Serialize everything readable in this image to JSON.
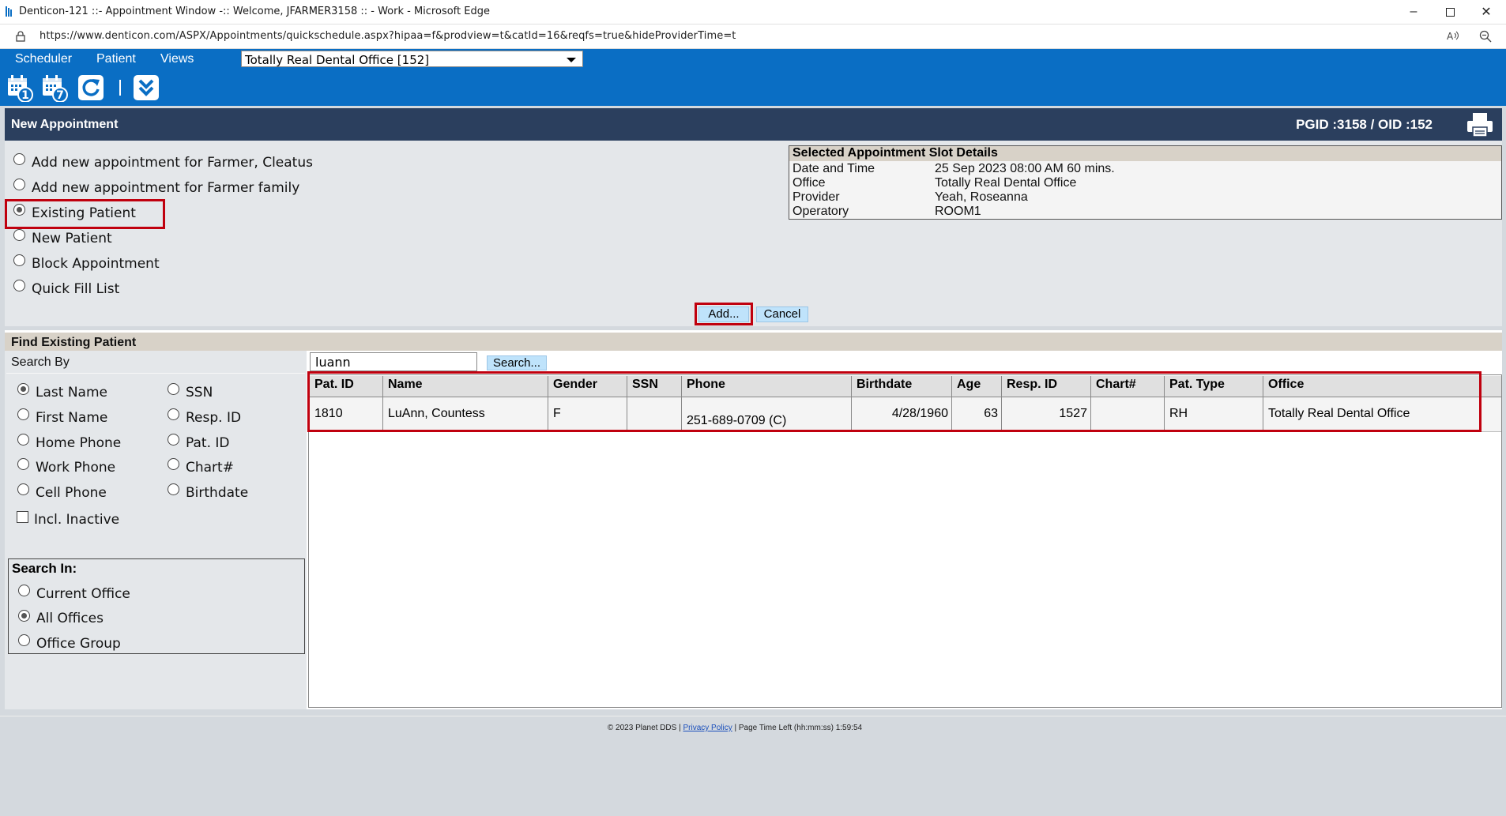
{
  "window": {
    "title": "Denticon-121 ::- Appointment Window -:: Welcome, JFARMER3158 :: - Work - Microsoft Edge",
    "url": "https://www.denticon.com/ASPX/Appointments/quickschedule.aspx?hipaa=f&prodview=t&catId=16&reqfs=true&hideProviderTime=t"
  },
  "menu": {
    "scheduler": "Scheduler",
    "patient": "Patient",
    "views": "Views",
    "office_select": "Totally Real Dental Office [152]"
  },
  "toolbar": {
    "cal1_num": "1",
    "cal7_num": "7"
  },
  "header": {
    "title": "New Appointment",
    "pgid": "PGID :3158  /  OID :152"
  },
  "options": [
    {
      "label": "Add new appointment for Farmer, Cleatus",
      "selected": false
    },
    {
      "label": "Add new appointment for Farmer family",
      "selected": false
    },
    {
      "label": "Existing Patient",
      "selected": true
    },
    {
      "label": "New Patient",
      "selected": false
    },
    {
      "label": "Block Appointment",
      "selected": false
    },
    {
      "label": "Quick Fill List",
      "selected": false
    }
  ],
  "slot": {
    "title": "Selected Appointment Slot Details",
    "rows": [
      {
        "label": "Date and Time",
        "value": "25 Sep 2023 08:00 AM 60 mins."
      },
      {
        "label": "Office",
        "value": "Totally Real Dental Office"
      },
      {
        "label": "Provider",
        "value": "Yeah, Roseanna"
      },
      {
        "label": "Operatory",
        "value": "ROOM1"
      }
    ]
  },
  "buttons": {
    "add": "Add...",
    "cancel": "Cancel",
    "search": "Search..."
  },
  "find": {
    "title": "Find Existing Patient",
    "search_by": "Search By",
    "search_by_left": [
      {
        "label": "Last Name",
        "selected": true
      },
      {
        "label": "First Name",
        "selected": false
      },
      {
        "label": "Home Phone",
        "selected": false
      },
      {
        "label": "Work Phone",
        "selected": false
      },
      {
        "label": "Cell Phone",
        "selected": false
      }
    ],
    "search_by_right": [
      {
        "label": "SSN",
        "selected": false
      },
      {
        "label": "Resp. ID",
        "selected": false
      },
      {
        "label": "Pat. ID",
        "selected": false
      },
      {
        "label": "Chart#",
        "selected": false
      },
      {
        "label": "Birthdate",
        "selected": false
      }
    ],
    "incl_inactive": "Incl. Inactive",
    "search_in": "Search In:",
    "search_in_options": [
      {
        "label": "Current Office",
        "selected": false
      },
      {
        "label": "All Offices",
        "selected": true
      },
      {
        "label": "Office Group",
        "selected": false
      }
    ],
    "search_value": "luann"
  },
  "results": {
    "columns": [
      "Pat. ID",
      "Name",
      "Gender",
      "SSN",
      "Phone",
      "Birthdate",
      "Age",
      "Resp. ID",
      "Chart#",
      "Pat. Type",
      "Office"
    ],
    "rows": [
      {
        "pat_id": "1810",
        "name": "LuAnn, Countess",
        "gender": "F",
        "ssn": "",
        "phone": "251-689-0709 (C)",
        "birthdate": "4/28/1960",
        "age": "63",
        "resp_id": "1527",
        "chart": "",
        "pat_type": "RH",
        "office": "Totally Real Dental Office"
      }
    ]
  },
  "footer": {
    "copyright": "© 2023 Planet DDS |",
    "privacy": "Privacy Policy",
    "time_left": "| Page Time Left (hh:mm:ss) 1:59:54"
  },
  "colors": {
    "menu_blue": "#0a6ec4",
    "header_navy": "#2b3f5e",
    "highlight_red": "#c0000e",
    "button_blue": "#bfe3fb"
  }
}
